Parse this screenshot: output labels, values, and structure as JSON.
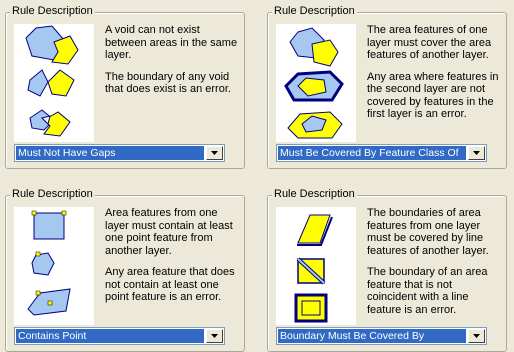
{
  "panels": [
    {
      "legend": "Rule Description",
      "paragraphs": [
        "A void can not exist between areas in the same layer.",
        "The boundary of any void that does exist is an error."
      ],
      "selected_rule": "Must Not Have Gaps"
    },
    {
      "legend": "Rule Description",
      "paragraphs": [
        "The area features of one layer must cover the area features of another layer.",
        "Any area where features in the second layer are not covered by features in the first layer is an error."
      ],
      "selected_rule": "Must Be Covered By Feature Class Of"
    },
    {
      "legend": "Rule Description",
      "paragraphs": [
        "Area features from one layer must contain at least one point feature from another layer.",
        "Any area feature that does not contain at least one point feature is an error."
      ],
      "selected_rule": "Contains Point"
    },
    {
      "legend": "Rule Description",
      "paragraphs": [
        "The boundaries of area features from one layer must be covered by line features of another layer.",
        "The boundary of an area feature that is not coincident with a line feature is an error."
      ],
      "selected_rule": "Boundary Must Be Covered By"
    }
  ],
  "colors": {
    "polygon_blue": "#a6c8f0",
    "polygon_yellow": "#ffff00",
    "selection_blue": "#316ac5",
    "outline_navy": "#000080"
  },
  "icons": [
    "chevron-down-icon"
  ]
}
